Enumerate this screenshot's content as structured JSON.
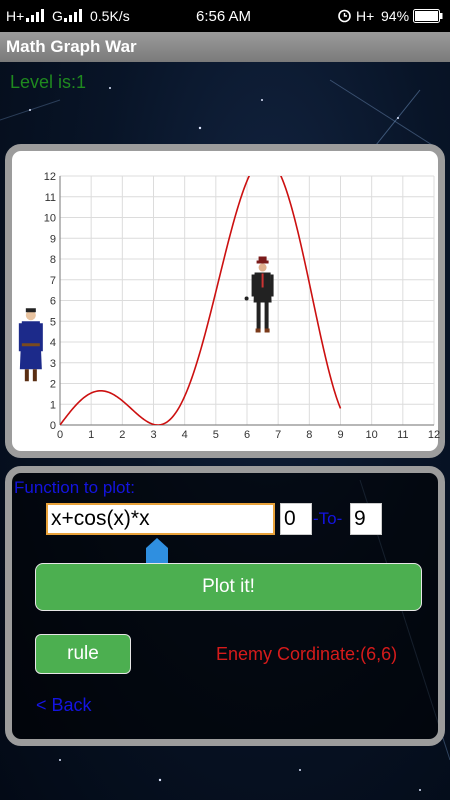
{
  "status_bar": {
    "network": "H+",
    "network2": "G",
    "speed": "0.5K/s",
    "time": "6:56 AM",
    "network3": "H+",
    "battery": "94%"
  },
  "app": {
    "title": "Math Graph War"
  },
  "game": {
    "level_text": "Level is:1",
    "enemy_coordinate_text": "Enemy Cordinate:(6,6)"
  },
  "chart_data": {
    "type": "line",
    "function": "x+cos(x)*x",
    "x_range": [
      0,
      9
    ],
    "xlim": [
      0,
      12
    ],
    "ylim": [
      0,
      12
    ],
    "x_ticks": [
      "0",
      "1",
      "2",
      "3",
      "4",
      "5",
      "6",
      "7",
      "8",
      "9",
      "10",
      "11",
      "12"
    ],
    "y_ticks": [
      "0",
      "1",
      "2",
      "3",
      "4",
      "5",
      "6",
      "7",
      "8",
      "9",
      "10",
      "11",
      "12"
    ],
    "grid": true,
    "line_color": "#cc1010",
    "player_position": [
      -1,
      1
    ],
    "enemy_position": [
      6.5,
      6
    ]
  },
  "controls": {
    "function_label": "Function to plot:",
    "function_value": "x+cos(x)*x",
    "from_value": "0",
    "to_label": "-To-",
    "to_value": "9",
    "plot_button": "Plot it!",
    "rule_button": "rule",
    "back_link": "< Back"
  },
  "colors": {
    "accent_green": "#4caf50",
    "label_blue": "#1414e0",
    "enemy_red": "#d61b1b",
    "level_green": "#1f8a1f"
  }
}
